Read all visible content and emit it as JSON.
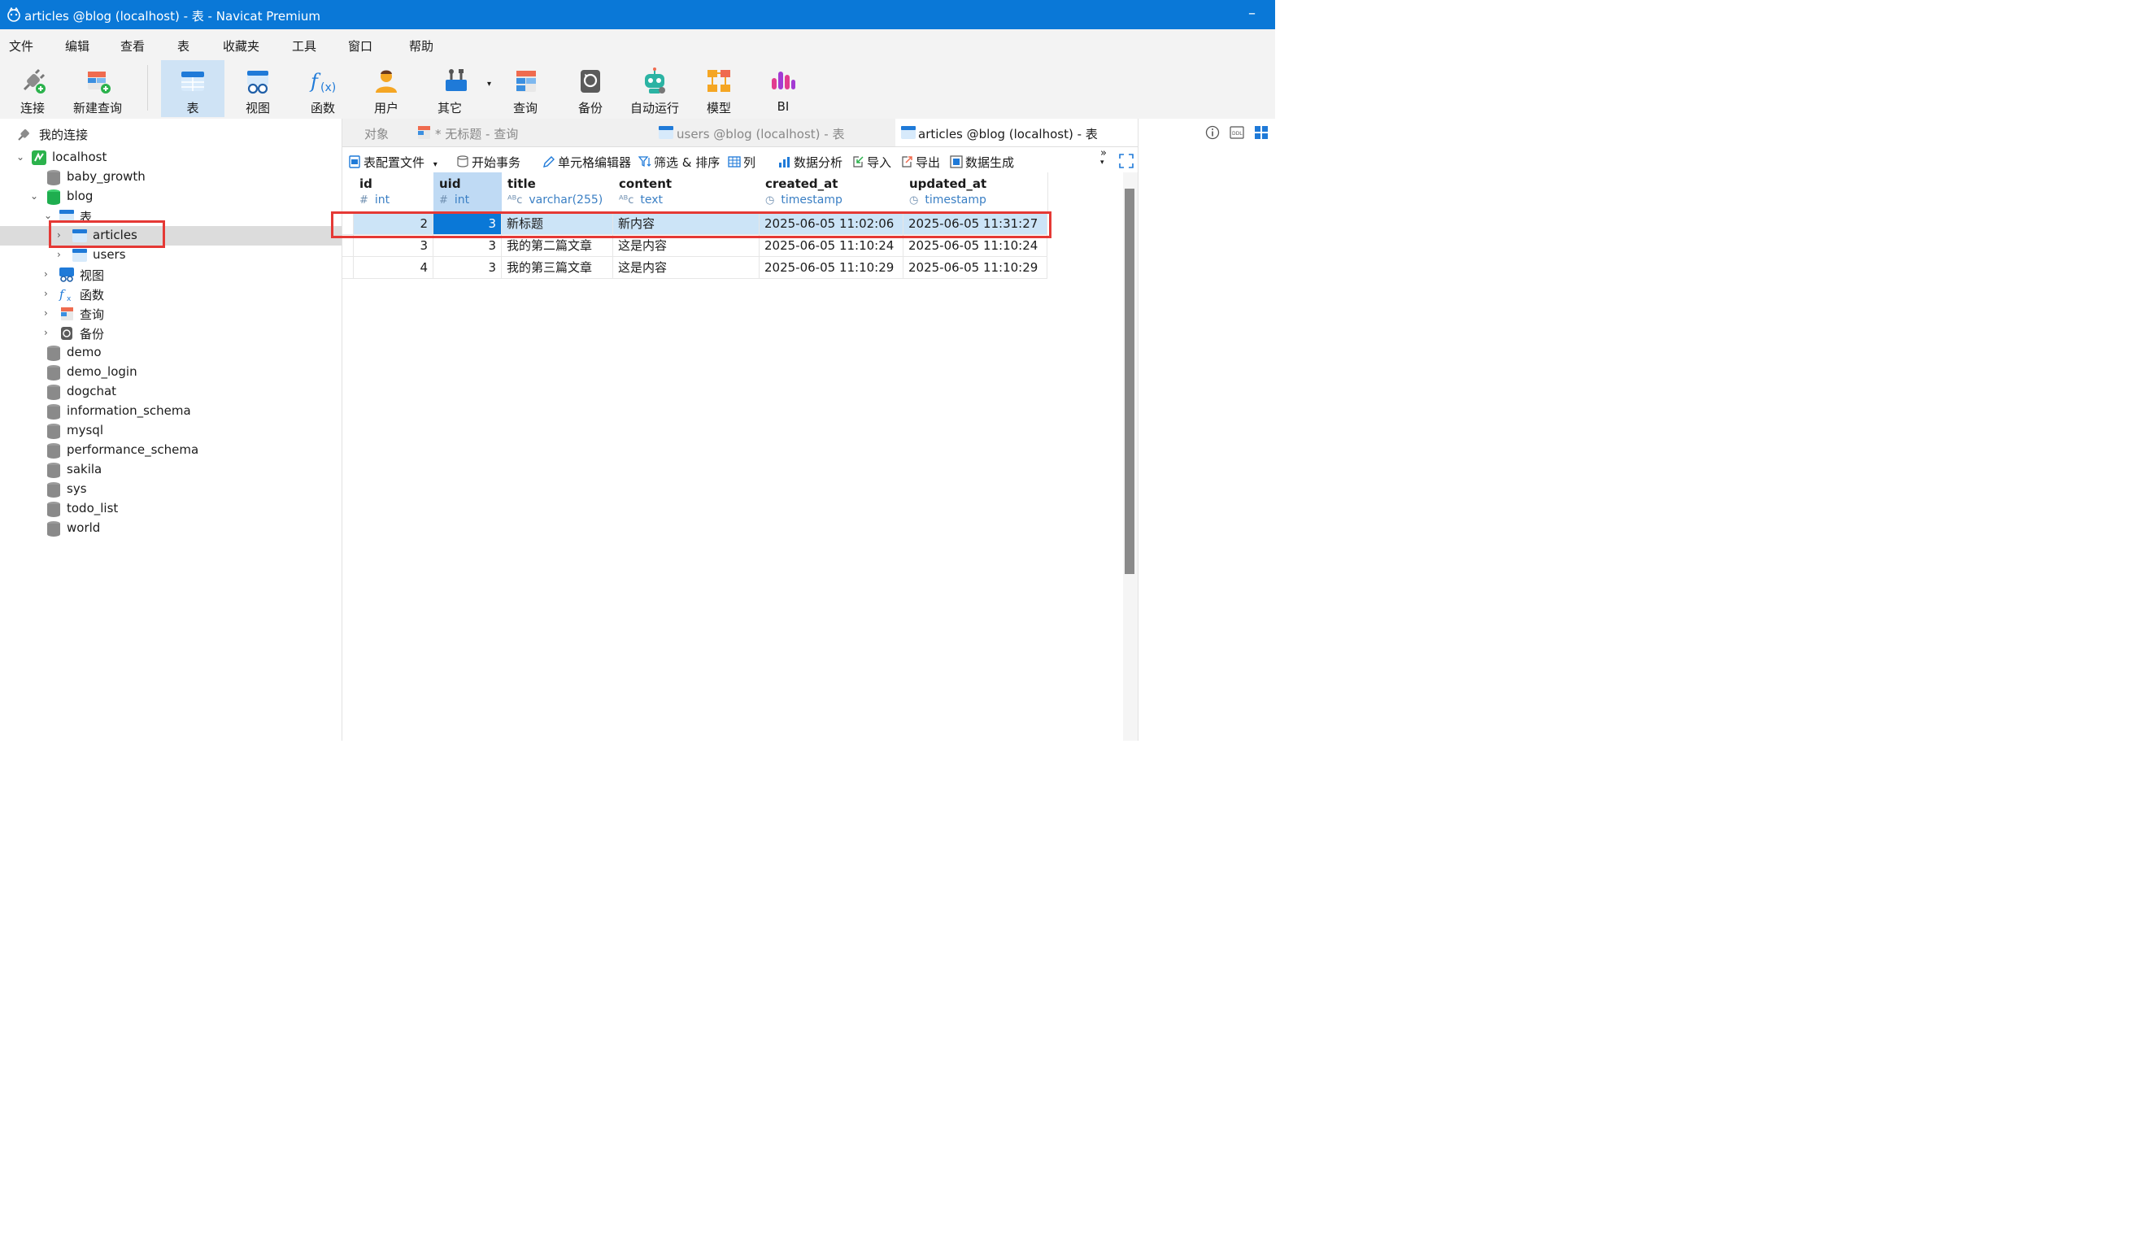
{
  "window": {
    "title": "articles @blog (localhost) - 表 - Navicat Premium",
    "minimize": "–"
  },
  "menu": [
    "文件",
    "编辑",
    "查看",
    "表",
    "收藏夹",
    "工具",
    "窗口",
    "帮助"
  ],
  "toolbar": {
    "connect": "连接",
    "new_query": "新建查询",
    "table": "表",
    "view": "视图",
    "function": "函数",
    "user": "用户",
    "other": "其它",
    "query": "查询",
    "backup": "备份",
    "automation": "自动运行",
    "model": "模型",
    "bi": "BI"
  },
  "sidebar": {
    "header": "我的连接",
    "connection": "localhost",
    "databases_before": [
      "baby_growth"
    ],
    "open_db": "blog",
    "tables_group": "表",
    "tables": [
      "articles",
      "users"
    ],
    "groups": [
      "视图",
      "函数",
      "查询",
      "备份"
    ],
    "databases_after": [
      "demo",
      "demo_login",
      "dogchat",
      "information_schema",
      "mysql",
      "performance_schema",
      "sakila",
      "sys",
      "todo_list",
      "world"
    ],
    "selected_table": "articles"
  },
  "tabs": {
    "objects": "对象",
    "untitled_query": "* 无标题 - 查询",
    "users_table": "users @blog (localhost) - 表",
    "articles_table": "articles @blog (localhost) - 表"
  },
  "subtoolbar": {
    "table_profile": "表配置文件",
    "begin_transaction": "开始事务",
    "cell_editor": "单元格编辑器",
    "filter_sort": "筛选 & 排序",
    "columns": "列",
    "data_analysis": "数据分析",
    "import": "导入",
    "export": "导出",
    "data_generation": "数据生成",
    "more": "»"
  },
  "grid": {
    "columns": [
      {
        "name": "id",
        "type": "int",
        "type_icon": "#"
      },
      {
        "name": "uid",
        "type": "int",
        "type_icon": "#"
      },
      {
        "name": "title",
        "type": "varchar(255)",
        "type_icon": "ᴬᴮc"
      },
      {
        "name": "content",
        "type": "text",
        "type_icon": "ᴬᴮc"
      },
      {
        "name": "created_at",
        "type": "timestamp",
        "type_icon": "◷"
      },
      {
        "name": "updated_at",
        "type": "timestamp",
        "type_icon": "◷"
      }
    ],
    "rows": [
      [
        "2",
        "3",
        "新标题",
        "新内容",
        "2025-06-05 11:02:06",
        "2025-06-05 11:31:27"
      ],
      [
        "3",
        "3",
        "我的第二篇文章",
        "这是内容",
        "2025-06-05 11:10:24",
        "2025-06-05 11:10:24"
      ],
      [
        "4",
        "3",
        "我的第三篇文章",
        "这是内容",
        "2025-06-05 11:10:29",
        "2025-06-05 11:10:29"
      ]
    ],
    "selected_row": 0,
    "selected_column": "uid"
  },
  "colors": {
    "accent": "#0a78d7",
    "highlight": "#e53935",
    "selection": "#cce4f7"
  }
}
